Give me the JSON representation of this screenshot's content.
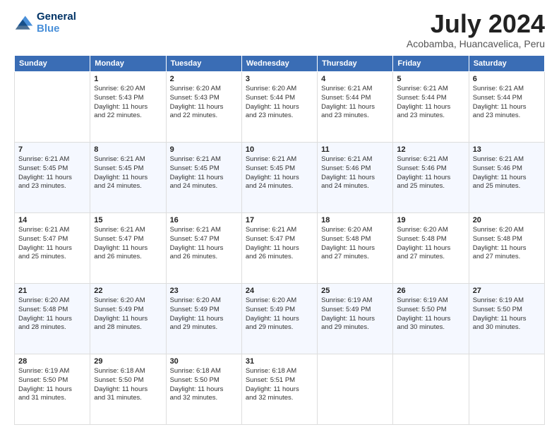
{
  "logo": {
    "line1": "General",
    "line2": "Blue"
  },
  "title": "July 2024",
  "subtitle": "Acobamba, Huancavelica, Peru",
  "days_of_week": [
    "Sunday",
    "Monday",
    "Tuesday",
    "Wednesday",
    "Thursday",
    "Friday",
    "Saturday"
  ],
  "weeks": [
    [
      {
        "day": "",
        "info": ""
      },
      {
        "day": "1",
        "info": "Sunrise: 6:20 AM\nSunset: 5:43 PM\nDaylight: 11 hours\nand 22 minutes."
      },
      {
        "day": "2",
        "info": "Sunrise: 6:20 AM\nSunset: 5:43 PM\nDaylight: 11 hours\nand 22 minutes."
      },
      {
        "day": "3",
        "info": "Sunrise: 6:20 AM\nSunset: 5:44 PM\nDaylight: 11 hours\nand 23 minutes."
      },
      {
        "day": "4",
        "info": "Sunrise: 6:21 AM\nSunset: 5:44 PM\nDaylight: 11 hours\nand 23 minutes."
      },
      {
        "day": "5",
        "info": "Sunrise: 6:21 AM\nSunset: 5:44 PM\nDaylight: 11 hours\nand 23 minutes."
      },
      {
        "day": "6",
        "info": "Sunrise: 6:21 AM\nSunset: 5:44 PM\nDaylight: 11 hours\nand 23 minutes."
      }
    ],
    [
      {
        "day": "7",
        "info": "Sunrise: 6:21 AM\nSunset: 5:45 PM\nDaylight: 11 hours\nand 23 minutes."
      },
      {
        "day": "8",
        "info": "Sunrise: 6:21 AM\nSunset: 5:45 PM\nDaylight: 11 hours\nand 24 minutes."
      },
      {
        "day": "9",
        "info": "Sunrise: 6:21 AM\nSunset: 5:45 PM\nDaylight: 11 hours\nand 24 minutes."
      },
      {
        "day": "10",
        "info": "Sunrise: 6:21 AM\nSunset: 5:45 PM\nDaylight: 11 hours\nand 24 minutes."
      },
      {
        "day": "11",
        "info": "Sunrise: 6:21 AM\nSunset: 5:46 PM\nDaylight: 11 hours\nand 24 minutes."
      },
      {
        "day": "12",
        "info": "Sunrise: 6:21 AM\nSunset: 5:46 PM\nDaylight: 11 hours\nand 25 minutes."
      },
      {
        "day": "13",
        "info": "Sunrise: 6:21 AM\nSunset: 5:46 PM\nDaylight: 11 hours\nand 25 minutes."
      }
    ],
    [
      {
        "day": "14",
        "info": "Sunrise: 6:21 AM\nSunset: 5:47 PM\nDaylight: 11 hours\nand 25 minutes."
      },
      {
        "day": "15",
        "info": "Sunrise: 6:21 AM\nSunset: 5:47 PM\nDaylight: 11 hours\nand 26 minutes."
      },
      {
        "day": "16",
        "info": "Sunrise: 6:21 AM\nSunset: 5:47 PM\nDaylight: 11 hours\nand 26 minutes."
      },
      {
        "day": "17",
        "info": "Sunrise: 6:21 AM\nSunset: 5:47 PM\nDaylight: 11 hours\nand 26 minutes."
      },
      {
        "day": "18",
        "info": "Sunrise: 6:20 AM\nSunset: 5:48 PM\nDaylight: 11 hours\nand 27 minutes."
      },
      {
        "day": "19",
        "info": "Sunrise: 6:20 AM\nSunset: 5:48 PM\nDaylight: 11 hours\nand 27 minutes."
      },
      {
        "day": "20",
        "info": "Sunrise: 6:20 AM\nSunset: 5:48 PM\nDaylight: 11 hours\nand 27 minutes."
      }
    ],
    [
      {
        "day": "21",
        "info": "Sunrise: 6:20 AM\nSunset: 5:48 PM\nDaylight: 11 hours\nand 28 minutes."
      },
      {
        "day": "22",
        "info": "Sunrise: 6:20 AM\nSunset: 5:49 PM\nDaylight: 11 hours\nand 28 minutes."
      },
      {
        "day": "23",
        "info": "Sunrise: 6:20 AM\nSunset: 5:49 PM\nDaylight: 11 hours\nand 29 minutes."
      },
      {
        "day": "24",
        "info": "Sunrise: 6:20 AM\nSunset: 5:49 PM\nDaylight: 11 hours\nand 29 minutes."
      },
      {
        "day": "25",
        "info": "Sunrise: 6:19 AM\nSunset: 5:49 PM\nDaylight: 11 hours\nand 29 minutes."
      },
      {
        "day": "26",
        "info": "Sunrise: 6:19 AM\nSunset: 5:50 PM\nDaylight: 11 hours\nand 30 minutes."
      },
      {
        "day": "27",
        "info": "Sunrise: 6:19 AM\nSunset: 5:50 PM\nDaylight: 11 hours\nand 30 minutes."
      }
    ],
    [
      {
        "day": "28",
        "info": "Sunrise: 6:19 AM\nSunset: 5:50 PM\nDaylight: 11 hours\nand 31 minutes."
      },
      {
        "day": "29",
        "info": "Sunrise: 6:18 AM\nSunset: 5:50 PM\nDaylight: 11 hours\nand 31 minutes."
      },
      {
        "day": "30",
        "info": "Sunrise: 6:18 AM\nSunset: 5:50 PM\nDaylight: 11 hours\nand 32 minutes."
      },
      {
        "day": "31",
        "info": "Sunrise: 6:18 AM\nSunset: 5:51 PM\nDaylight: 11 hours\nand 32 minutes."
      },
      {
        "day": "",
        "info": ""
      },
      {
        "day": "",
        "info": ""
      },
      {
        "day": "",
        "info": ""
      }
    ]
  ]
}
